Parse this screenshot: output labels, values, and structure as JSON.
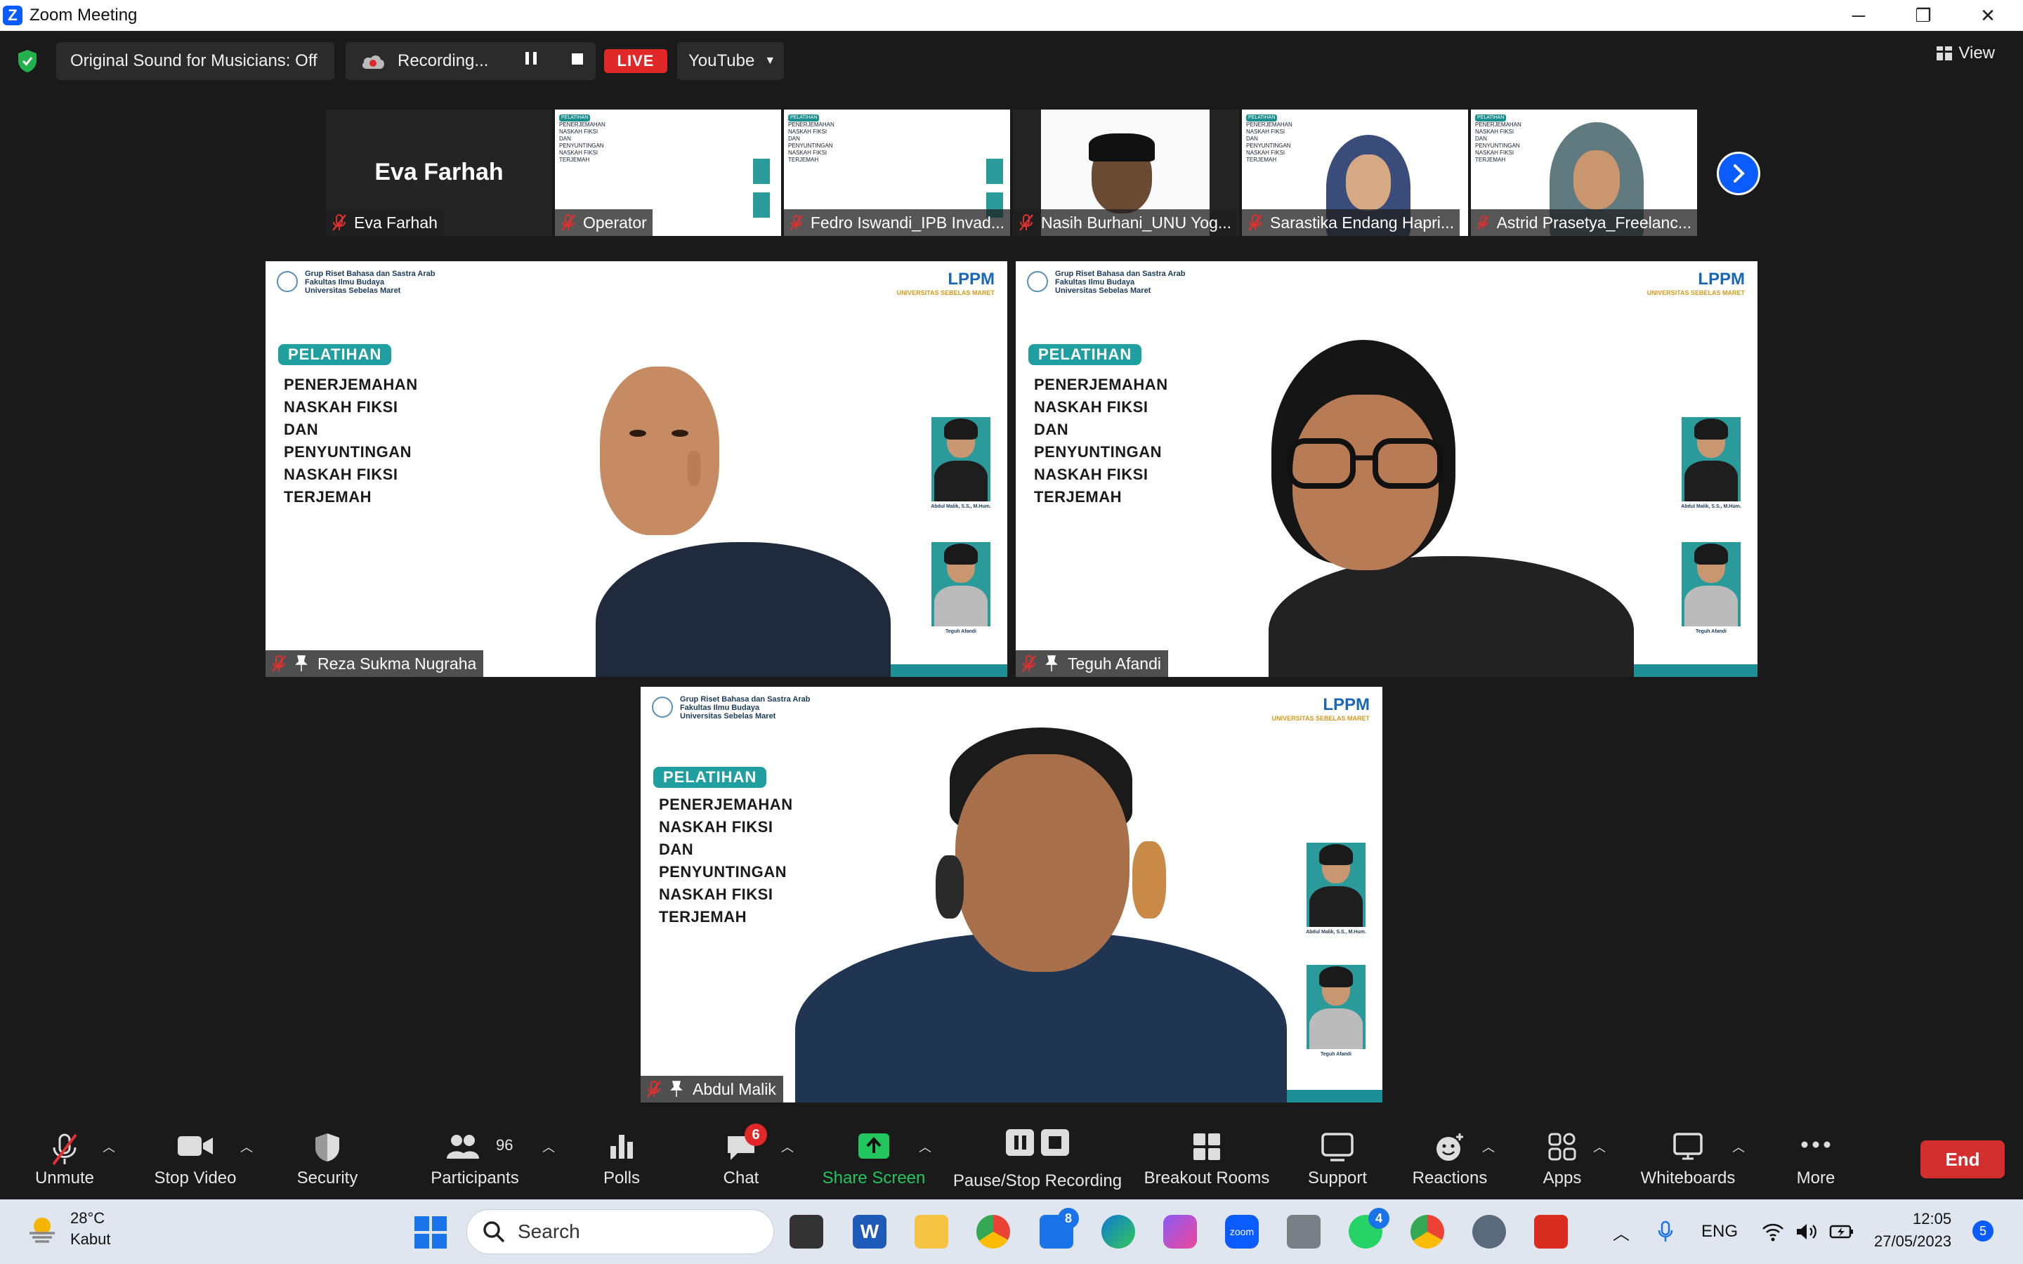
{
  "window": {
    "title": "Zoom Meeting",
    "controls": [
      "─",
      "❐",
      "✕"
    ]
  },
  "topbar": {
    "sound_label": "Original Sound for Musicians: Off",
    "recording_label": "Recording...",
    "live_label": "LIVE",
    "stream_target": "YouTube",
    "view_label": "View"
  },
  "thumbnails": [
    {
      "name": "Eva Farhah",
      "big_name": "Eva Farhah"
    },
    {
      "name": "Operator"
    },
    {
      "name": "Fedro Iswandi_IPB Invad..."
    },
    {
      "name": "Nasih Burhani_UNU Yog..."
    },
    {
      "name": "Sarastika Endang Hapri..."
    },
    {
      "name": "Astrid Prasetya_Freelanc..."
    }
  ],
  "slide": {
    "org_line1": "Grup Riset Bahasa dan Sastra Arab",
    "org_line2": "Fakultas Ilmu Budaya",
    "org_line3": "Universitas Sebelas Maret",
    "lppm": "LPPM",
    "lppm_sub": "UNIVERSITAS SEBELAS MARET",
    "badge": "PELATIHAN",
    "title_lines": [
      "PENERJEMAHAN",
      "NASKAH FIKSI",
      "DAN",
      "PENYUNTINGAN",
      "NASKAH FIKSI",
      "TERJEMAH"
    ],
    "speaker1": "Abdul Malik, S.S., M.Hum.",
    "speaker2": "Teguh Afandi"
  },
  "tiles": [
    {
      "name": "Reza Sukma Nugraha"
    },
    {
      "name": "Teguh Afandi"
    },
    {
      "name": "Abdul Malik"
    }
  ],
  "toolbar": {
    "unmute": "Unmute",
    "stop_video": "Stop Video",
    "security": "Security",
    "participants": "Participants",
    "participants_count": "96",
    "polls": "Polls",
    "chat": "Chat",
    "chat_badge": "6",
    "share_screen": "Share Screen",
    "pause_recording": "Pause/Stop Recording",
    "breakout": "Breakout Rooms",
    "support": "Support",
    "reactions": "Reactions",
    "apps": "Apps",
    "whiteboards": "Whiteboards",
    "more": "More",
    "end": "End"
  },
  "taskbar": {
    "temperature": "28°C",
    "weather": "Kabut",
    "search_placeholder": "Search",
    "teams_badge": "8",
    "whatsapp_badge": "4",
    "language": "ENG",
    "time": "12:05",
    "date": "27/05/2023",
    "notifications": "5"
  },
  "colors": {
    "accent": "#0b5cff",
    "live": "#e02828",
    "end": "#d32f2f",
    "share_green": "#22c55e",
    "slide_teal": "#1f9f9f"
  }
}
